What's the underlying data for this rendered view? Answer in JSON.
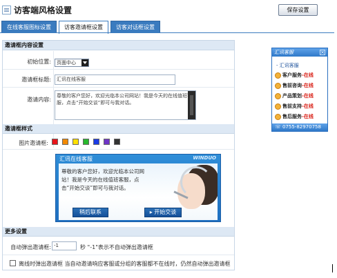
{
  "header": {
    "title": "访客端风格设置",
    "save_label": "保存设置"
  },
  "tabs": [
    {
      "label": "在线客服图标设置",
      "active": false
    },
    {
      "label": "访客邀请框设置",
      "active": true
    },
    {
      "label": "访客对话框设置",
      "active": false
    }
  ],
  "invite_content": {
    "section_title": "邀请框内容设置",
    "position_label": "初始位置:",
    "position_value": "页面中心",
    "title_label": "邀请框标题:",
    "title_value": "汇讯在线客服",
    "content_label": "邀请内容:",
    "content_value": "尊敬的客户您好，欢迎光临本公司网站！我是今天的在线值班客服，点击“开始交谈”即可与我对话。"
  },
  "invite_style": {
    "section_title": "邀请框样式",
    "image_label": "图片邀请框:",
    "colors": [
      "#e8151b",
      "#f28a00",
      "#ffe000",
      "#27b82d",
      "#1a3be6",
      "#6f35c8",
      "#333333"
    ]
  },
  "preview": {
    "title": "汇讯在线客服",
    "brand": "WINDUO",
    "message": "尊敬的客户您好，欢迎光临本公司网站！我是今天的在线值班客服，点击“开始交谈”即可与我对话。",
    "later_label": "稍后联系",
    "start_label": "▸ 开始交谈"
  },
  "more": {
    "section_title": "更多设置",
    "delay_label": "自动弹出邀请框:",
    "delay_value": "-1",
    "delay_hint": "秒 \"-1\"表示不自动弹出邀请框",
    "offline_label": "离线时弹出邀请框 当自动邀请响应客服或分组的客服都不在线时，仍然自动弹出邀请框"
  },
  "widget": {
    "title": "汇讯客服",
    "close": "×",
    "group": "- 汇讯客服",
    "items": [
      {
        "name": "客户服务",
        "status": "-在线"
      },
      {
        "name": "售前咨询",
        "status": "-在线"
      },
      {
        "name": "产品策划",
        "status": "-在线"
      },
      {
        "name": "售前支持",
        "status": "-在线"
      },
      {
        "name": "售后服务",
        "status": "-在线"
      }
    ],
    "phone": "☏ 0755-82970758"
  }
}
